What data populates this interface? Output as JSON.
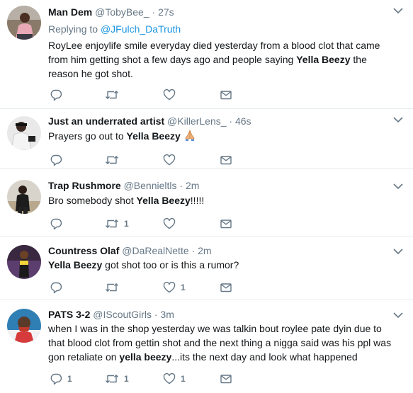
{
  "tweets": [
    {
      "display_name": "Man Dem",
      "handle": "@TobyBee_",
      "separator": "·",
      "time": "27s",
      "replying_prefix": "Replying to ",
      "replying_to": "@JFulch_DaTruth",
      "text_parts": [
        "RoyLee enjoylife smile everyday died yesterday from a blood clot that came from him getting shot a few days ago and people saying ",
        "Yella Beezy",
        " the reason he got shot."
      ],
      "reply_count": "",
      "retweet_count": "",
      "like_count": ""
    },
    {
      "display_name": "Just an underrated artist",
      "handle": "@KillerLens_",
      "separator": "·",
      "time": "46s",
      "text_parts": [
        "Prayers go out to ",
        "Yella Beezy",
        " "
      ],
      "emoji": "folded-hands-emoji",
      "reply_count": "",
      "retweet_count": "",
      "like_count": ""
    },
    {
      "display_name": "Trap Rushmore",
      "handle": "@Bennieltls",
      "separator": "·",
      "time": "2m",
      "text_parts": [
        "Bro somebody shot ",
        "Yella Beezy",
        "!!!!!"
      ],
      "reply_count": "",
      "retweet_count": "1",
      "like_count": ""
    },
    {
      "display_name": "Countress Olaf",
      "handle": "@DaRealNette",
      "separator": "·",
      "time": "2m",
      "text_parts": [
        "",
        "Yella Beezy",
        " got shot too or is this a rumor?"
      ],
      "reply_count": "",
      "retweet_count": "",
      "like_count": "1"
    },
    {
      "display_name": "PATS 3-2",
      "handle": "@IScoutGirls",
      "separator": "·",
      "time": "3m",
      "text_parts": [
        "when I was in the shop yesterday we was talkin bout roylee pate dyin due to that blood clot from gettin shot and the next thing a nigga said was his ppl was gon retaliate on ",
        "yella beezy",
        "...its the next day and look what happened"
      ],
      "reply_count": "1",
      "retweet_count": "1",
      "like_count": "1"
    }
  ],
  "colors": {
    "text": "#14171a",
    "secondary": "#657786",
    "link": "#1b95e0",
    "divider": "#e6ecf0"
  },
  "icons": [
    "reply-icon",
    "retweet-icon",
    "like-icon",
    "direct-message-icon",
    "caret-down-icon"
  ]
}
